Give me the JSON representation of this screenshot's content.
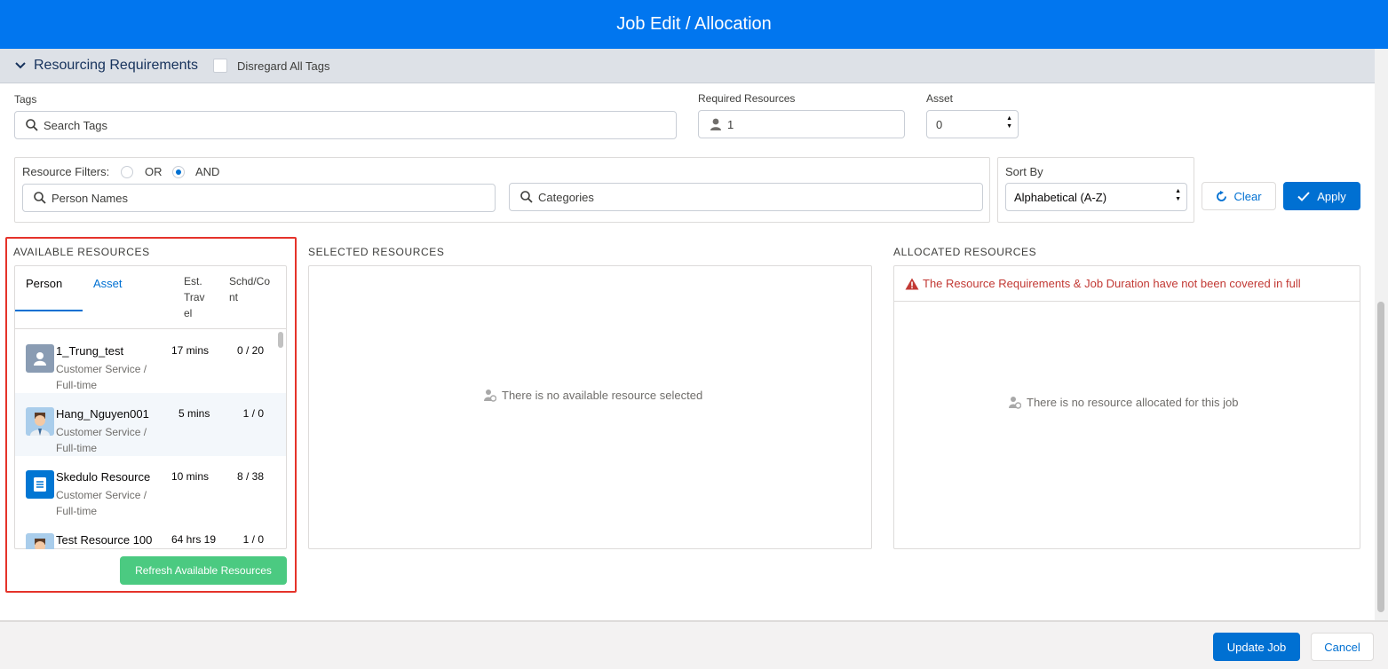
{
  "header": {
    "title": "Job Edit / Allocation"
  },
  "section": {
    "title": "Resourcing Requirements",
    "disregard_label": "Disregard All Tags"
  },
  "tags": {
    "label": "Tags",
    "placeholder": "Search Tags"
  },
  "required_resources": {
    "label": "Required Resources",
    "value": "1"
  },
  "asset": {
    "label": "Asset",
    "value": "0"
  },
  "filters": {
    "label": "Resource Filters:",
    "or_label": "OR",
    "and_label": "AND",
    "selected": "AND",
    "person_placeholder": "Person Names",
    "categories_placeholder": "Categories"
  },
  "sort": {
    "label": "Sort By",
    "value": "Alphabetical (A-Z)"
  },
  "buttons": {
    "clear": "Clear",
    "apply": "Apply",
    "refresh": "Refresh Available Resources",
    "update_job": "Update Job",
    "cancel": "Cancel"
  },
  "available": {
    "heading": "AVAILABLE RESOURCES",
    "tabs": [
      "Person",
      "Asset"
    ],
    "col_travel": [
      "Est.",
      "Trav",
      "el"
    ],
    "col_sched": [
      "Schd/Co",
      "nt"
    ],
    "rows": [
      {
        "name": "1_Trung_test",
        "sub1": "Customer Service /",
        "sub2": "Full-time",
        "travel": "17 mins",
        "sched": "0 / 20",
        "avatar": "person-placeholder-icon"
      },
      {
        "name": "Hang_Nguyen001",
        "sub1": "Customer Service /",
        "sub2": "Full-time",
        "travel": "5 mins",
        "sched": "1 / 0",
        "avatar": "user-photo-avatar"
      },
      {
        "name": "Skedulo Resource",
        "sub1": "Customer Service /",
        "sub2": "Full-time",
        "travel": "10 mins",
        "sched": "8 / 38",
        "avatar": "document-icon"
      },
      {
        "name": "Test Resource 100",
        "sub1": "",
        "sub2": "",
        "travel": "64 hrs 19",
        "sched": "1 / 0",
        "avatar": "user-photo-avatar"
      }
    ]
  },
  "selected": {
    "heading": "SELECTED RESOURCES",
    "empty": "There is no available resource selected"
  },
  "allocated": {
    "heading": "ALLOCATED RESOURCES",
    "warning": "The Resource Requirements & Job Duration have not been covered in full",
    "empty": "There is no resource allocated for this job"
  },
  "colors": {
    "header": "#0176ef",
    "brand": "#0070d2",
    "success": "#4bca81",
    "error": "#c23934",
    "highlight": "#e5332a"
  }
}
